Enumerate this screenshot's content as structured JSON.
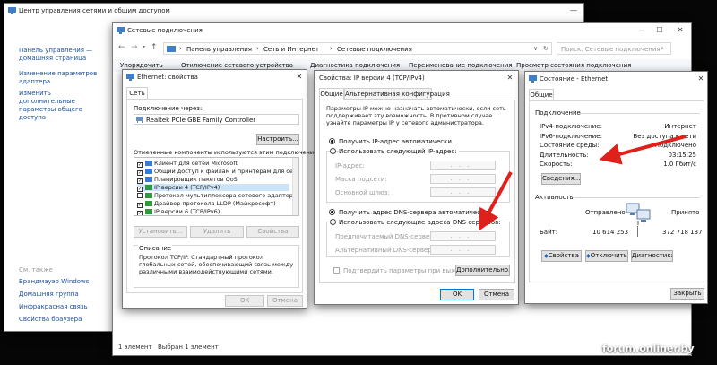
{
  "control_panel": {
    "title": "Центр управления сетями и общим доступом",
    "sidebar_home": "Панель управления — домашняя страница",
    "change_adapter": "Изменение параметров адаптера",
    "change_sharing": "Изменить дополнительные параметры общего доступа",
    "see_also": "См. также",
    "see_also_items": [
      "Брандмауэр Windows",
      "Домашняя группа",
      "Инфракрасная связь",
      "Свойства браузера"
    ],
    "min": "—"
  },
  "net_connections": {
    "title": "Сетевые подключения",
    "breadcrumb": [
      "Панель управления",
      "Сеть и Интернет",
      "Сетевые подключения"
    ],
    "search_placeholder": "Поиск: Сетевые подключения",
    "toolbar": [
      "Упорядочить",
      "Отключение сетевого устройства",
      "Диагностика подключения",
      "Переименование подключения",
      "Просмотр состояния подключения"
    ],
    "status_items": "1 элемент",
    "status_selected": "Выбран 1 элемент",
    "min": "—",
    "max": "☐",
    "close": "✕"
  },
  "eth_props": {
    "title": "Ethernet: свойства",
    "tab": "Сеть",
    "connect_via": "Подключение через:",
    "adapter": "Realtek PCIe GBE Family Controller",
    "configure": "Настроить...",
    "components_label": "Отмеченные компоненты используются этим подключением:",
    "components": [
      {
        "label": "Клиент для сетей Microsoft",
        "checked": true,
        "color": "#3a7ad0"
      },
      {
        "label": "Общий доступ к файлам и принтерам для сетей",
        "checked": true,
        "color": "#3a7ad0"
      },
      {
        "label": "Планировщик пакетов QoS",
        "checked": true,
        "color": "#3a7ad0"
      },
      {
        "label": "IP версии 4 (TCP/IPv4)",
        "checked": true,
        "color": "#2e9a3c"
      },
      {
        "label": "Протокол мультиплексора сетевого адаптера (Ма",
        "checked": false,
        "color": "#2e9a3c"
      },
      {
        "label": "Драйвер протокола LLDP (Майкрософт)",
        "checked": true,
        "color": "#2e9a3c"
      },
      {
        "label": "IP версии 6 (TCP/IPv6)",
        "checked": true,
        "color": "#2e9a3c"
      }
    ],
    "install": "Установить...",
    "remove": "Удалить",
    "properties": "Свойства",
    "description_title": "Описание",
    "description": "Протокол TCP/IP. Стандартный протокол глобальных сетей, обеспечивающий связь между различными взаимодействующими сетями.",
    "ok": "OK",
    "cancel": "Отмена"
  },
  "ipv4_props": {
    "title": "Свойства: IP версии 4 (TCP/IPv4)",
    "tab_general": "Общие",
    "tab_alt": "Альтернативная конфигурация",
    "intro": "Параметры IP можно назначать автоматически, если сеть поддерживает эту возможность. В противном случае узнайте параметры IP у сетевого администратора.",
    "ip_auto": "Получить IP-адрес автоматически",
    "ip_manual": "Использовать следующий IP-адрес:",
    "ip_address": "IP-адрес:",
    "subnet_mask": "Маска подсети:",
    "gateway": "Основной шлюз:",
    "dns_auto": "Получить адрес DNS-сервера автоматически",
    "dns_manual": "Использовать следующие адреса DNS-серверов:",
    "dns_preferred": "Предпочитаемый DNS-сервер:",
    "dns_alternate": "Альтернативный DNS-сервер:",
    "validate": "Подтвердить параметры при выходе",
    "advanced": "Дополнительно...",
    "ip_placeholder": "...",
    "ok": "OK",
    "cancel": "Отмена"
  },
  "eth_status": {
    "title": "Состояние - Ethernet",
    "tab": "Общие",
    "connection_label": "Подключение",
    "rows": [
      {
        "label": "IPv4-подключение:",
        "value": "Интернет"
      },
      {
        "label": "IPv6-подключение:",
        "value": "Без доступа к сети"
      },
      {
        "label": "Состояние среды:",
        "value": "Подключено"
      },
      {
        "label": "Длительность:",
        "value": "03:15:25"
      },
      {
        "label": "Скорость:",
        "value": "1.0 Гбит/с"
      }
    ],
    "details": "Сведения...",
    "activity_label": "Активность",
    "sent_label": "Отправлено",
    "received_label": "Принято",
    "bytes_label": "Байт:",
    "sent_bytes": "10 614 253",
    "received_bytes": "372 718 137",
    "properties": "Свойства",
    "disable": "Отключить",
    "diagnose": "Диагностика",
    "close": "Закрыть"
  },
  "watermark": "forum.onliner.by",
  "colors": {
    "arrow": "#e0201a",
    "link": "#1a4e9c",
    "accent": "#0078d7"
  }
}
